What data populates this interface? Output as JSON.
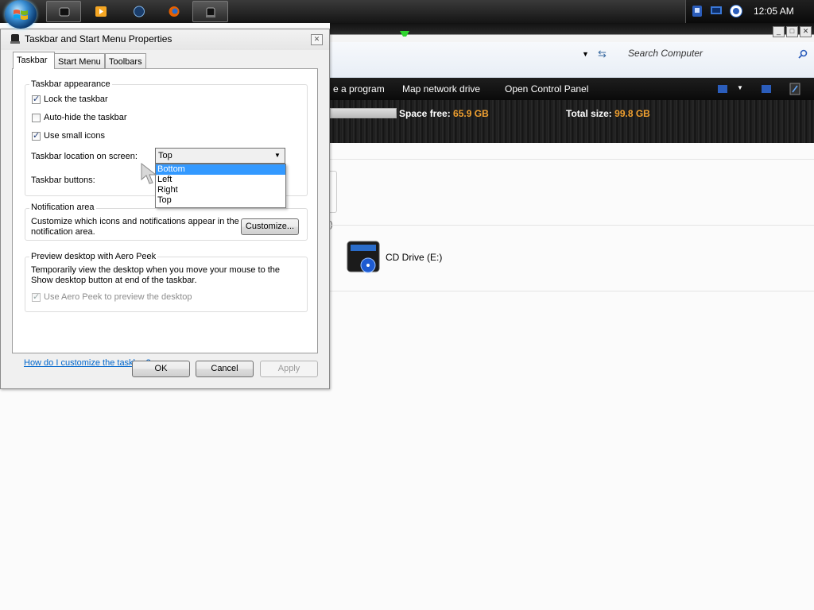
{
  "taskbar": {
    "time": "12:05 AM",
    "pinned": [
      {
        "name": "taskbar-properties-icon",
        "active": true
      },
      {
        "name": "media-player-icon",
        "active": false
      },
      {
        "name": "app-globe-icon",
        "active": false
      },
      {
        "name": "firefox-icon",
        "active": false
      },
      {
        "name": "taskbar-properties-window-icon",
        "active": true
      }
    ],
    "tray_icons": [
      "network-icon",
      "monitor-icon",
      "globe-icon"
    ]
  },
  "explorer": {
    "search_placeholder": "Search Computer",
    "commands": {
      "uninstall": "e a program",
      "map_drive": "Map network drive",
      "control_panel": "Open Control Panel"
    },
    "details": {
      "space_free_label": "Space free:",
      "space_free_value": "65.9 GB",
      "total_size_label": "Total size:",
      "total_size_value": "99.8 GB"
    },
    "cd_drive_label": "CD Drive (E:)"
  },
  "dialog": {
    "title": "Taskbar and Start Menu Properties",
    "tabs": [
      "Taskbar",
      "Start Menu",
      "Toolbars"
    ],
    "appearance": {
      "title": "Taskbar appearance",
      "lock_taskbar": {
        "label": "Lock the taskbar",
        "checked": true
      },
      "auto_hide": {
        "label": "Auto-hide the taskbar",
        "checked": false
      },
      "small_icons": {
        "label": "Use small icons",
        "checked": true
      },
      "location_label": "Taskbar location on screen:",
      "location_value": "Top",
      "location_options": [
        "Bottom",
        "Left",
        "Right",
        "Top"
      ],
      "location_highlighted": "Bottom",
      "buttons_label": "Taskbar buttons:"
    },
    "notification": {
      "title": "Notification area",
      "description_line1": "Customize which icons and notifications appear in the",
      "description_line2": "notification area.",
      "customize_button": "Customize..."
    },
    "aero_peek": {
      "title": "Preview desktop with Aero Peek",
      "description_line1": "Temporarily view the desktop when you move your mouse to the",
      "description_line2": "Show desktop button at end of the taskbar.",
      "checkbox_label": "Use Aero Peek to preview the desktop",
      "checked": true,
      "disabled": true
    },
    "help_link": "How do I customize the taskbar?",
    "buttons": {
      "ok": "OK",
      "cancel": "Cancel",
      "apply": "Apply"
    }
  },
  "colors": {
    "accent_orange": "#f0a030",
    "selection_blue": "#3399ff",
    "link_blue": "#0066cc"
  }
}
